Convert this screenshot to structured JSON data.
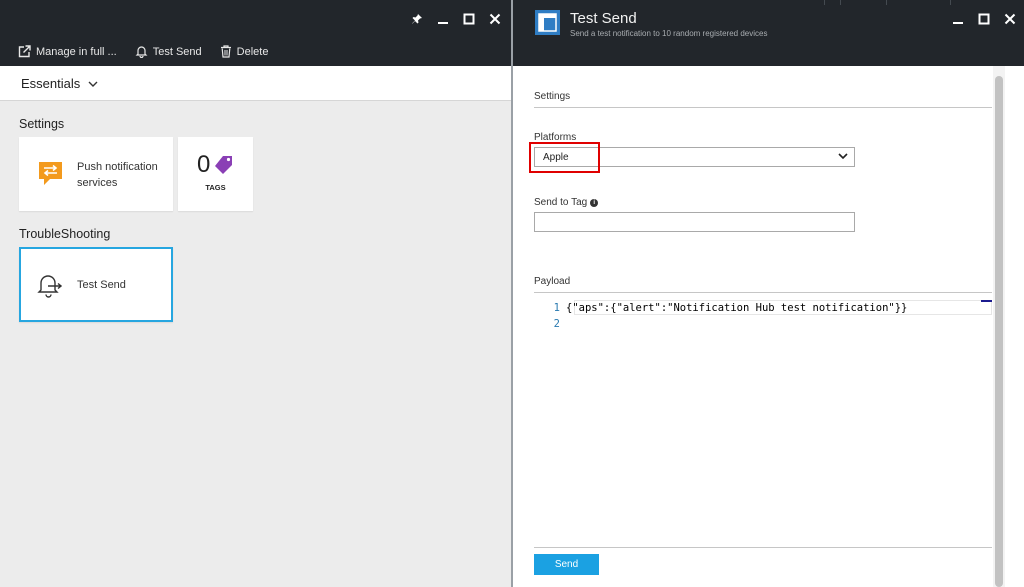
{
  "left_blade": {
    "toolbar": {
      "manage_label": "Manage in full ...",
      "test_send_label": "Test Send",
      "delete_label": "Delete"
    },
    "essentials_label": "Essentials",
    "settings_section": "Settings",
    "tiles": {
      "push_line1": "Push notification",
      "push_line2": "services",
      "tags_count": "0",
      "tags_label": "TAGS"
    },
    "troubleshooting_section": "TroubleShooting",
    "test_send_tile": "Test Send"
  },
  "right_blade": {
    "title": "Test Send",
    "subtitle": "Send a test notification to 10 random registered devices",
    "settings_header": "Settings",
    "platforms_label": "Platforms",
    "platform_value": "Apple",
    "send_to_tag_label": "Send to Tag",
    "send_to_tag_value": "",
    "payload_label": "Payload",
    "payload_lines": [
      {
        "num": "1",
        "code": "{\"aps\":{\"alert\":\"Notification Hub test notification\"}}"
      },
      {
        "num": "2",
        "code": ""
      }
    ],
    "send_button": "Send"
  },
  "colors": {
    "chrome": "#22262b",
    "accent": "#1ba1e2",
    "highlight": "#e00000",
    "push_icon": "#f39a1d",
    "tag_icon": "#8a3fb5"
  },
  "icons": [
    "pin-icon",
    "minimize-icon",
    "maximize-icon",
    "close-icon",
    "external-link-icon",
    "bell-icon",
    "trash-icon",
    "chevron-down-icon",
    "push-notification-icon",
    "tag-icon",
    "bell-send-icon",
    "info-icon",
    "blade-icon"
  ]
}
